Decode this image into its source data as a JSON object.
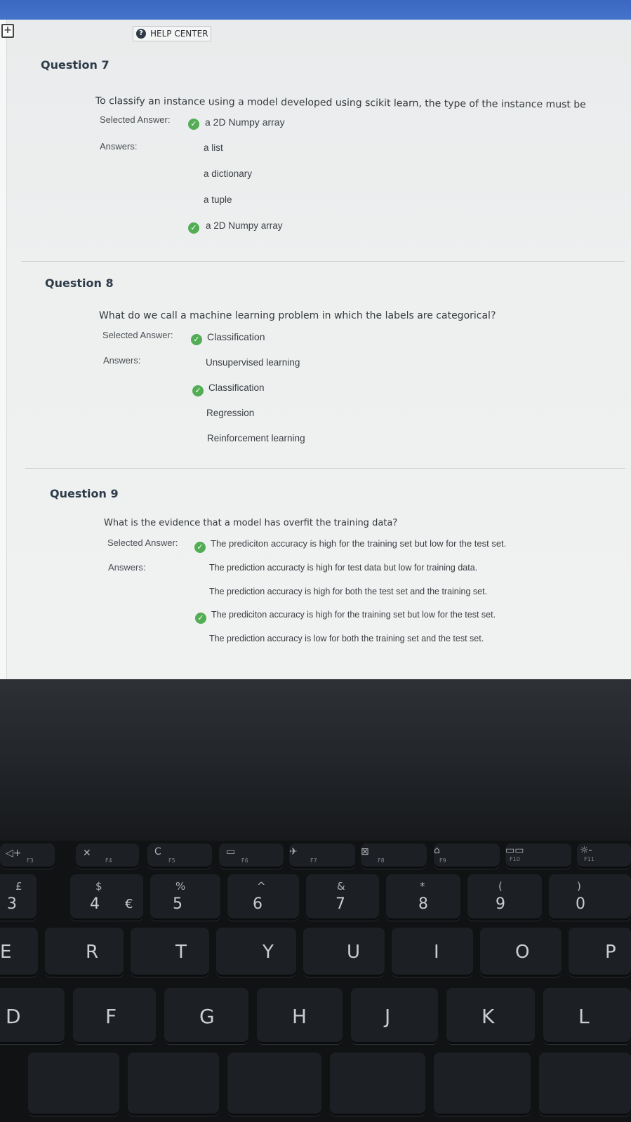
{
  "header": {
    "help_center": "HELP CENTER"
  },
  "questions": [
    {
      "title": "Question 7",
      "text": "To classify an instance using a model developed using scikit learn, the type of the instance must be",
      "selected_label": "Selected Answer:",
      "selected_answer": "a 2D Numpy array",
      "answers_label": "Answers:",
      "answers": [
        "a list",
        "a dictionary",
        "a tuple",
        "a 2D Numpy array"
      ],
      "correct_index": 3
    },
    {
      "title": "Question 8",
      "text": "What do we call a machine learning problem in which the labels are categorical?",
      "selected_label": "Selected Answer:",
      "selected_answer": "Classification",
      "answers_label": "Answers:",
      "answers": [
        "Unsupervised learning",
        "Classification",
        "Regression",
        "Reinforcement learning"
      ],
      "correct_index": 1
    },
    {
      "title": "Question 9",
      "text": "What is the evidence that a model has overfit the training data?",
      "selected_label": "Selected Answer:",
      "selected_answer": "The prediciton accuracy is high for the training set but low for the test set.",
      "answers_label": "Answers:",
      "answers": [
        "The prediction accuracty is high for test data but low for training data.",
        "The prediction accuracy is high for both the test set and the training set.",
        "The prediciton accuracy is high for the training set but low for the test set.",
        "The prediction accuracy is low for both the training set and the test set."
      ],
      "correct_index": 2
    }
  ],
  "keyboard": {
    "fn_labels": [
      "F3",
      "F4",
      "F5",
      "F6",
      "F7",
      "F8",
      "F9",
      "F10",
      "F11"
    ],
    "number_row": [
      {
        "top": "£",
        "main": "3"
      },
      {
        "top": "$",
        "main": "4",
        "extra": "€"
      },
      {
        "top": "%",
        "main": "5"
      },
      {
        "top": "^",
        "main": "6"
      },
      {
        "top": "&",
        "main": "7"
      },
      {
        "top": "*",
        "main": "8"
      },
      {
        "top": "(",
        "main": "9"
      },
      {
        "top": ")",
        "main": "0"
      }
    ],
    "letter_row_1": [
      "E",
      "R",
      "T",
      "Y",
      "U",
      "I",
      "O",
      "P"
    ],
    "letter_row_2": [
      "D",
      "F",
      "G",
      "H",
      "J",
      "K",
      "L"
    ]
  }
}
